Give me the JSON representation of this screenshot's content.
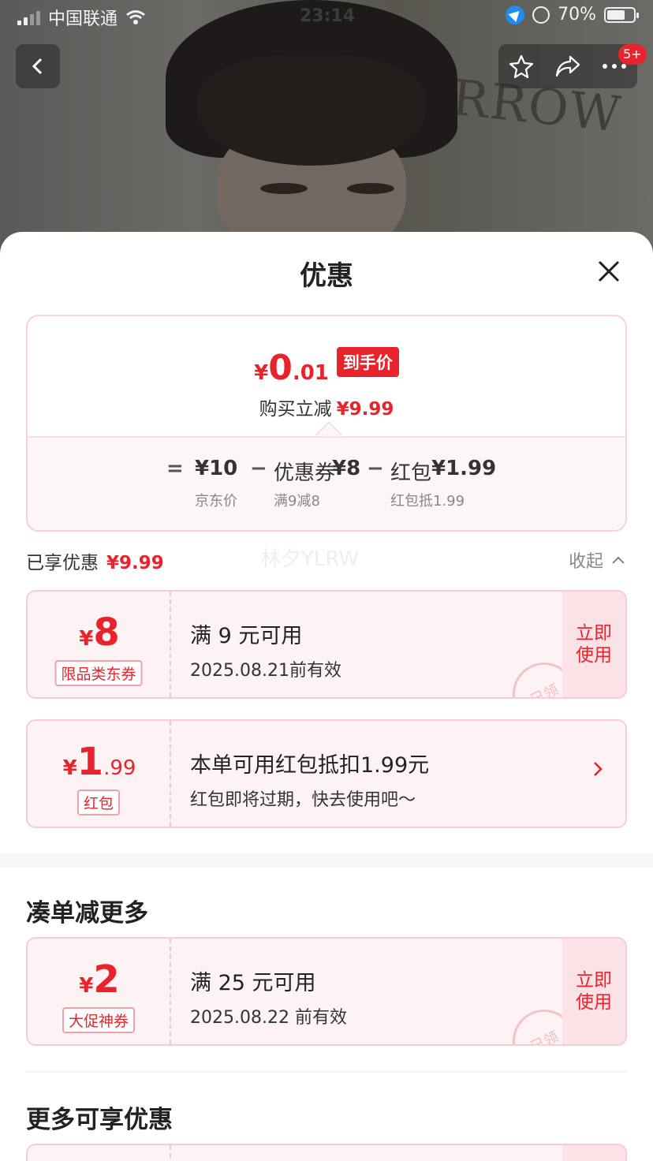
{
  "status_bar": {
    "carrier": "中国联通",
    "time": "23:14",
    "battery": "70%"
  },
  "nav": {
    "badge": "5+"
  },
  "background": {
    "brand_text": "ORROW"
  },
  "sheet": {
    "title": "优惠",
    "price": {
      "yen": "¥",
      "integer": "0",
      "decimal": ".01",
      "tag": "到手价",
      "saving_label": "购买立减",
      "saving_amount": "¥9.99"
    },
    "formula": {
      "eq": "=",
      "base": "¥10",
      "base_label": "京东价",
      "minus1": "−",
      "coupon_label_top": "优惠券",
      "coupon_value": "¥8",
      "coupon_desc": "满9减8",
      "minus2": "−",
      "redpacket_label_top": "红包",
      "redpacket_value": "¥1.99",
      "redpacket_desc": "红包抵1.99"
    },
    "enjoyed": {
      "label": "已享优惠",
      "amount": "¥9.99",
      "collapse": "收起",
      "watermark": "林夕YLRW"
    },
    "coupons": [
      {
        "yen": "¥",
        "amount": "8",
        "decimal": "",
        "label": "限品类东券",
        "main": "满 9 元可用",
        "sub": "2025.08.21前有效",
        "action": "立即使用",
        "stamp": "已领"
      },
      {
        "yen": "¥",
        "amount": "1",
        "decimal": ".99",
        "label": "红包",
        "main": "本单可用红包抵扣1.99元",
        "sub": "红包即将过期，快去使用吧～"
      }
    ],
    "section_more_discount": {
      "title": "凑单减更多",
      "coupon": {
        "yen": "¥",
        "amount": "2",
        "label": "大促神券",
        "main": "满 25 元可用",
        "sub": "2025.08.22 前有效",
        "action": "立即使用",
        "stamp": "已领"
      }
    },
    "section_more_benefits": {
      "title": "更多可享优惠"
    }
  },
  "colors": {
    "accent": "#e8232b",
    "coupon_bg": "#fdf3f4",
    "border": "#f5cdd3"
  }
}
